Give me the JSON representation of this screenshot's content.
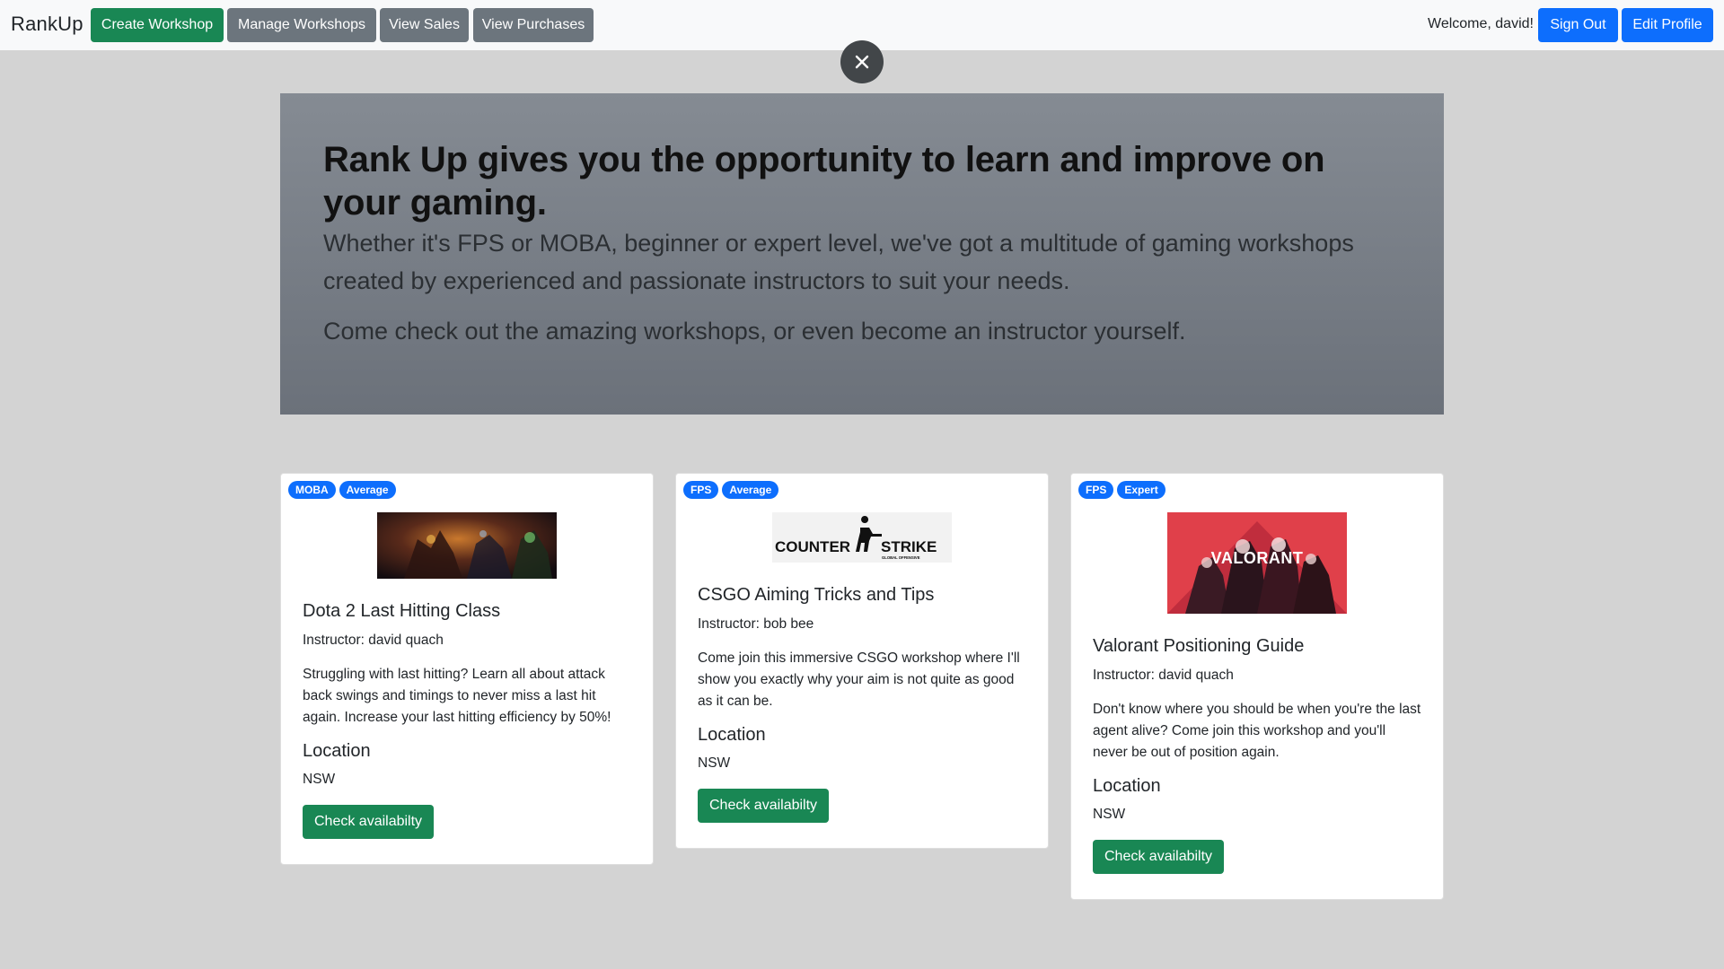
{
  "navbar": {
    "brand": "RankUp",
    "create_workshop": "Create Workshop",
    "manage_workshops": "Manage Workshops",
    "view_sales": "View Sales",
    "view_purchases": "View Purchases",
    "welcome": "Welcome, david!",
    "sign_out": "Sign Out",
    "edit_profile": "Edit Profile"
  },
  "close_button_icon": "close-icon",
  "hero": {
    "heading": "Rank Up gives you the opportunity to learn and improve on your gaming.",
    "lead1": "Whether it's FPS or MOBA, beginner or expert level, we've got a multitude of gaming workshops created by experienced and passionate instructors to suit your needs.",
    "lead2": "Come check out the amazing workshops, or even become an instructor yourself."
  },
  "cards": [
    {
      "badges": [
        "MOBA",
        "Average"
      ],
      "image": "dota-2-banner",
      "title": "Dota 2 Last Hitting Class",
      "instructor": "Instructor: david quach",
      "description": "Struggling with last hitting? Learn all about attack back swings and timings to never miss a last hit again. Increase your last hitting efficiency by 50%!",
      "location_label": "Location",
      "location": "NSW",
      "button": "Check availabilty"
    },
    {
      "badges": [
        "FPS",
        "Average"
      ],
      "image": "counter-strike-logo",
      "image_text_left": "COUNTER",
      "image_text_right": "STRIKE",
      "image_subtext": "GLOBAL OFFENSIVE",
      "title": "CSGO Aiming Tricks and Tips",
      "instructor": "Instructor: bob bee",
      "description": "Come join this immersive CSGO workshop where I'll show you exactly why your aim is not quite as good as it can be.",
      "location_label": "Location",
      "location": "NSW",
      "button": "Check availabilty"
    },
    {
      "badges": [
        "FPS",
        "Expert"
      ],
      "image": "valorant-banner",
      "image_text": "VALORANT",
      "title": "Valorant Positioning Guide",
      "instructor": "Instructor: david quach",
      "description": "Don't know where you should be when you're the last agent alive? Come join this workshop and you'll never be out of position again.",
      "location_label": "Location",
      "location": "NSW",
      "button": "Check availabilty"
    }
  ]
}
